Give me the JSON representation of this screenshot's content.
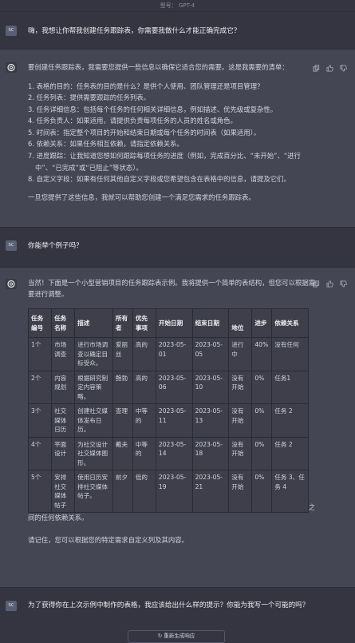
{
  "header": {
    "model_label": "型号： GPT-4"
  },
  "conversation": {
    "user_avatar": "SC",
    "q1": "嗨，我想让你帮我创建任务跟踪表，你需要我做什么才能正确完成它？",
    "a1": {
      "intro": "要创建任务跟踪表，我需要您提供一些信息以确保它适合您的需要。这是我需要的清单：",
      "items": [
        "1. 表格的目的：任务表的目的是什么？是供个人使用、团队管理还是项目管理？",
        "2. 任务列表：提供需要跟踪的任务列表。",
        "3. 任务详细信息：包括每个任务的任何相关详细信息，例如描述、优先级或复杂性。",
        "4. 任务负责人：如果适用，请提供负责每项任务的人员的姓名或角色。",
        "5. 时间表：指定整个项目的开始和结束日期或每个任务的时间表（如果适用）。",
        "6. 依赖关系：如果任务相互依赖，请指定依赖关系。",
        "7. 进度跟踪：让我知道您想如何跟踪每项任务的进度（例如，完成百分比、“未开始”、“进行",
        "中”、“已完成”或“已阻止”等状态）。",
        "8. 自定义字段：如果有任何其他自定义字段或您希望包含在表格中的信息，请提及它们。"
      ],
      "outro": "一旦您提供了这些信息，我就可以帮助您创建一个满足您需求的任务跟踪表。"
    },
    "q2": "你能举个例子吗？",
    "a2": {
      "intro": "当然！下面是一个小型营销项目的任务跟踪表示例。我将提供一个简单的表结构，但您可以根据需要进行调整。",
      "table": {
        "headers": [
          "任务编号",
          "任务名称",
          "描述",
          "所有者",
          "优先事项",
          "开始日期",
          "结束日期",
          "地位",
          "进步",
          "依赖关系"
        ],
        "rows": [
          [
            "1个",
            "市场调查",
            "进行市场调查以确定目标受众。",
            "爱丽丝",
            "高的",
            "2023-05-01",
            "2023-05-05",
            "进行中",
            "40%",
            "没有任何"
          ],
          [
            "2个",
            "内容规划",
            "根据研究制定内容策略。",
            "鲍勃",
            "高的",
            "2023-05-06",
            "2023-05-10",
            "没有开始",
            "0%",
            "任务1"
          ],
          [
            "3个",
            "社交媒体日历",
            "创建社交媒体发布日历。",
            "查理",
            "中等的",
            "2023-05-11",
            "2023-05-13",
            "没有开始",
            "0%",
            "任务 2"
          ],
          [
            "4个",
            "平面设计",
            "为社交设计社交媒体图形。",
            "戴夫",
            "中等的",
            "2023-05-14",
            "2023-05-18",
            "没有开始",
            "0%",
            "任务 2"
          ],
          [
            "5个",
            "安排社交媒体帖子",
            "使用日历安排社交媒体帖子。",
            "前夕",
            "低的",
            "2023-05-19",
            "2023-05-21",
            "没有开始",
            "0%",
            "任务 3、任务 4"
          ]
        ]
      },
      "summary": "在此示例中，表格显示任务列表及其详细信息，例如任务 ID、任务名称、描述、所有者、优先级、开始和结束日期、状态、进度和依赖关系。此信息可帮助您跟踪任务、它们的进度以及它们之间的任何依赖关系。",
      "closing": "请记住，您可以根据您的特定需求自定义列及其内容。"
    },
    "q3": "为了获得你在上次示例中制作的表格，我应该给出什么样的提示？你能为我写一个可能的吗？"
  },
  "footer": {
    "regenerate_label": "重新生成响应"
  }
}
